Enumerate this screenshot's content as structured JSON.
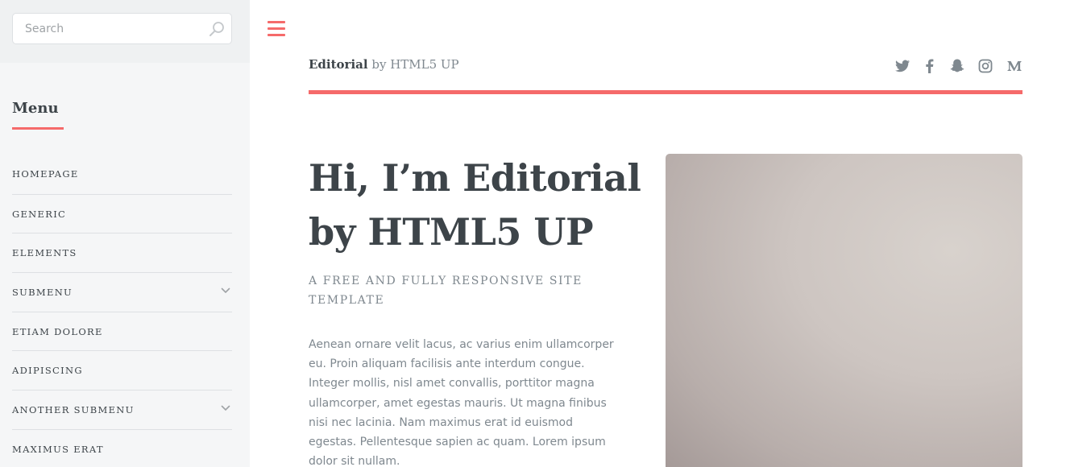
{
  "sidebar": {
    "search": {
      "placeholder": "Search",
      "value": ""
    },
    "menu_title": "Menu",
    "items": [
      {
        "label": "Homepage",
        "has_submenu": false
      },
      {
        "label": "Generic",
        "has_submenu": false
      },
      {
        "label": "Elements",
        "has_submenu": false
      },
      {
        "label": "Submenu",
        "has_submenu": true
      },
      {
        "label": "Etiam Dolore",
        "has_submenu": false
      },
      {
        "label": "Adipiscing",
        "has_submenu": false
      },
      {
        "label": "Another Submenu",
        "has_submenu": true
      },
      {
        "label": "Maximus Erat",
        "has_submenu": false
      }
    ]
  },
  "header": {
    "title_bold": "Editorial",
    "title_rest": " by HTML5 UP",
    "social_icons": [
      "twitter-icon",
      "facebook-icon",
      "snapchat-icon",
      "instagram-icon",
      "medium-icon"
    ]
  },
  "banner": {
    "title": "Hi, I’m Editorial by HTML5 UP",
    "subtitle": "A free and fully responsive site template",
    "body": "Aenean ornare velit lacus, ac varius enim ullamcorper eu. Proin aliquam facilisis ante interdum congue. Integer mollis, nisl amet convallis, porttitor magna ullamcorper, amet egestas mauris. Ut magna finibus nisi nec lacinia. Nam maximus erat id euismod egestas. Pellentesque sapien ac quam. Lorem ipsum dolor sit nullam."
  },
  "colors": {
    "accent": "#f56a6a",
    "heading": "#3d4449",
    "text": "#7f888f",
    "sidebar_bg": "#f5f6f7"
  }
}
